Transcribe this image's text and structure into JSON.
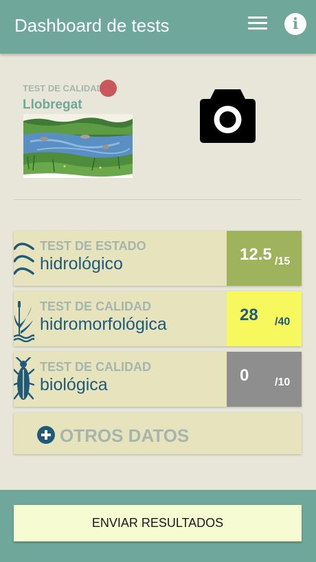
{
  "appbar": {
    "title": "Dashboard de tests",
    "menu_icon": "hamburger-menu-icon",
    "info_icon": "info-icon",
    "info_glyph": "i",
    "color": "#6fa89a"
  },
  "site": {
    "pretitle": "TEST DE CALIDAD",
    "name": "Llobregat",
    "status_color": "#c9575b",
    "photo_icon": "river-landscape-photo"
  },
  "camera": {
    "icon": "camera-icon"
  },
  "tests": [
    {
      "pretitle": "TEST DE ESTADO",
      "title": "hidrológico",
      "score": "12.5",
      "max": "/15",
      "icon": "waves-icon",
      "score_color": "#9fb35c",
      "text_color": "#ffffff"
    },
    {
      "pretitle": "TEST DE CALIDAD",
      "title": "hidromorfológica",
      "score": "28",
      "max": "/40",
      "icon": "reeds-icon",
      "score_color": "#f7f75e",
      "text_color": "#1f5a7a"
    },
    {
      "pretitle": "TEST DE CALIDAD",
      "title": "biológica",
      "score": "0",
      "max": "/10",
      "icon": "insect-icon",
      "score_color": "#8e8e8e",
      "text_color": "#ffffff"
    }
  ],
  "otros": {
    "label": "OTROS DATOS",
    "icon": "plus-circle-icon"
  },
  "footer": {
    "send_label": "ENVIAR RESULTADOS"
  }
}
